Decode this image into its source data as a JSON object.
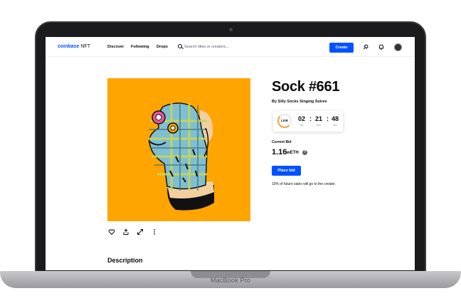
{
  "device": {
    "label": "MacBook Pro"
  },
  "nav": {
    "logo": "coinbase",
    "logo_suffix": "NFT",
    "links": [
      "Discover",
      "Following",
      "Drops"
    ],
    "search_placeholder": "Search titles or creators...",
    "create_label": "Create",
    "icons": [
      "search-icon",
      "rocket-icon",
      "bell-icon",
      "avatar"
    ]
  },
  "item": {
    "title": "Sock #661",
    "creator": "By Silly Socks Singing Soiree",
    "timer": {
      "live_label": "LIVE",
      "hours": "02",
      "minutes": "21",
      "seconds": "48",
      "hours_label": "hrs",
      "minutes_label": "min",
      "seconds_label": "sec"
    },
    "bid_label": "Current Bid",
    "bid_amount": "1.16",
    "bid_unit": "wETH",
    "place_bid_label": "Place bid",
    "royalty_note": "10% of future sales will go to the creator.",
    "action_icons": [
      "heart-icon",
      "share-icon",
      "expand-icon",
      "more-icon"
    ]
  },
  "description": {
    "title": "Description"
  },
  "colors": {
    "accent": "#0052ff",
    "artwork_bg": "#ffa502"
  }
}
